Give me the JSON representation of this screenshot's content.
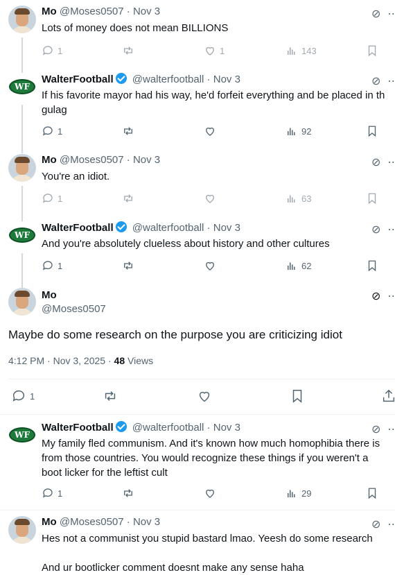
{
  "tweets": [
    {
      "name": "Mo",
      "handle": "@Moses0507",
      "date": "Nov 3",
      "text": [
        "Lots of money does not mean BILLIONS"
      ],
      "replies": "1",
      "retweets": "",
      "likes": "1",
      "views": "143"
    },
    {
      "name": "WalterFootball",
      "handle": "@walterfootball",
      "date": "Nov 3",
      "text": [
        "If his favorite mayor had his way, he'd forfeit everything and be placed in th",
        "gulag"
      ],
      "replies": "1",
      "retweets": "",
      "likes": "",
      "views": "92"
    },
    {
      "name": "Mo",
      "handle": "@Moses0507",
      "date": "Nov 3",
      "text": [
        "You're an idiot."
      ],
      "replies": "1",
      "retweets": "",
      "likes": "",
      "views": "63"
    },
    {
      "name": "WalterFootball",
      "handle": "@walterfootball",
      "date": "Nov 3",
      "text": [
        "And you're absolutely clueless about history and other cultures"
      ],
      "replies": "1",
      "retweets": "",
      "likes": "",
      "views": "62"
    }
  ],
  "main": {
    "name": "Mo",
    "handle": "@Moses0507",
    "text": "Maybe do some research on the purpose you are criticizing idiot",
    "timestamp": "4:12 PM · Nov 3, 2025 · ",
    "views_count": "48",
    "views_label": " Views",
    "replies": "1"
  },
  "reply1": {
    "name": "WalterFootball",
    "handle": "@walterfootball",
    "date": "Nov 3",
    "text": [
      "My family fled communism. And it's known how much homophibia there is",
      "from those countries. You would recognize these things if you weren't a",
      "boot licker for the leftist cult"
    ],
    "replies": "1",
    "views": "29"
  },
  "reply2": {
    "name": "Mo",
    "handle": "@Moses0507",
    "date": "Nov 3",
    "text": [
      "Hes not a communist you stupid bastard lmao.  Yeesh do some research",
      "",
      "And ur bootlicker comment doesnt make any sense haha"
    ]
  },
  "wf_logo_text": "WF",
  "separator": " · ",
  "colors": {
    "verified": "#1d9bf0",
    "muted": "#536471",
    "text": "#0f1419"
  }
}
